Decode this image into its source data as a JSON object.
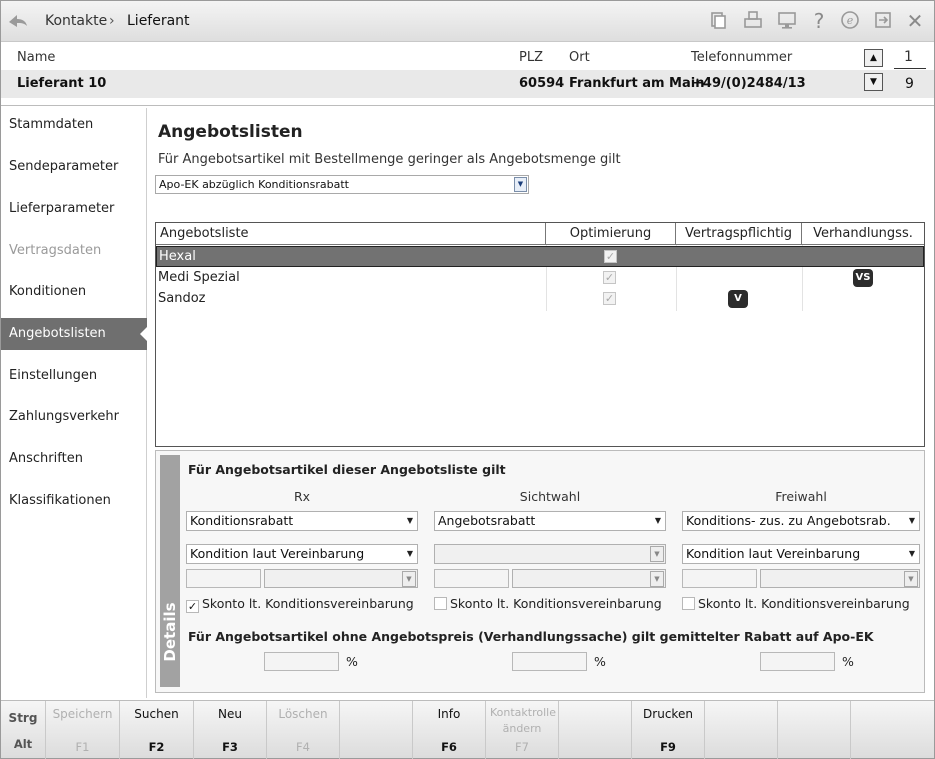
{
  "titlebar": {
    "breadcrumb": [
      "Kontakte",
      "Lieferant"
    ],
    "separator": "›",
    "icons": [
      "back-icon",
      "clipboard-icon",
      "printer-icon",
      "monitor-icon",
      "help-icon",
      "ebook-icon",
      "exit-icon",
      "close-icon"
    ]
  },
  "header": {
    "labels": {
      "name": "Name",
      "plz": "PLZ",
      "ort": "Ort",
      "tel": "Telefonnummer"
    },
    "values": {
      "name": "Lieferant 10",
      "plz": "60594",
      "ort": "Frankfurt am Main",
      "tel": "+49/(0)2484/13"
    },
    "page_current": "1",
    "page_total": "9"
  },
  "sidebar": {
    "items": [
      {
        "label": "Stammdaten",
        "state": "normal"
      },
      {
        "label": "Sendeparameter",
        "state": "normal"
      },
      {
        "label": "Lieferparameter",
        "state": "normal"
      },
      {
        "label": "Vertragsdaten",
        "state": "disabled"
      },
      {
        "label": "Konditionen",
        "state": "normal"
      },
      {
        "label": "Angebotslisten",
        "state": "active"
      },
      {
        "label": "Einstellungen",
        "state": "normal"
      },
      {
        "label": "Zahlungsverkehr",
        "state": "normal"
      },
      {
        "label": "Anschriften",
        "state": "normal"
      },
      {
        "label": "Klassifikationen",
        "state": "normal"
      }
    ]
  },
  "main": {
    "title": "Angebotslisten",
    "subtitle": "Für Angebotsartikel mit Bestellmenge geringer als Angebotsmenge gilt",
    "select_value": "Apo-EK abzüglich Konditionsrabatt",
    "table": {
      "headers": [
        "Angebotsliste",
        "Optimierung",
        "Vertragspflichtig",
        "Verhandlungss."
      ],
      "rows": [
        {
          "name": "Hexal",
          "optimierung": "✓",
          "vertrag": "",
          "verhandlung": "",
          "selected": true
        },
        {
          "name": "Medi Spezial",
          "optimierung": "✓",
          "vertrag": "",
          "verhandlung": "VS",
          "selected": false
        },
        {
          "name": "Sandoz",
          "optimierung": "✓",
          "vertrag": "V",
          "verhandlung": "",
          "selected": false
        }
      ]
    },
    "details": {
      "stripe": "Details",
      "heading1": "Für Angebotsartikel dieser Angebotsliste gilt",
      "columns": [
        {
          "head": "Rx",
          "combo1": "Konditionsrabatt",
          "combo2": "Kondition laut Vereinbarung",
          "skonto": "Skonto lt. Konditionsvereinbarung",
          "skonto_checked": "✓",
          "combo2_disabled": false
        },
        {
          "head": "Sichtwahl",
          "combo1": "Angebotsrabatt",
          "combo2": "",
          "skonto": "Skonto lt. Konditionsvereinbarung",
          "skonto_checked": "",
          "combo2_disabled": true
        },
        {
          "head": "Freiwahl",
          "combo1": "Konditions- zus. zu Angebotsrab.",
          "combo2": "Kondition laut Vereinbarung",
          "skonto": "Skonto lt. Konditionsvereinbarung",
          "skonto_checked": "",
          "combo2_disabled": false
        }
      ],
      "heading2": "Für Angebotsartikel ohne Angebotspreis (Verhandlungssache) gilt gemittelter Rabatt auf Apo-EK",
      "percent": "%"
    }
  },
  "footer": {
    "modifiers": [
      "Strg",
      "Alt"
    ],
    "keys": [
      {
        "label": "Speichern",
        "key": "F1",
        "enabled": false
      },
      {
        "label": "Suchen",
        "key": "F2",
        "enabled": true
      },
      {
        "label": "Neu",
        "key": "F3",
        "enabled": true
      },
      {
        "label": "Löschen",
        "key": "F4",
        "enabled": false
      },
      {
        "label": "",
        "key": "",
        "enabled": false
      },
      {
        "label": "Info",
        "key": "F6",
        "enabled": true
      },
      {
        "label": "Kontaktrolle ändern",
        "key": "F7",
        "enabled": false
      },
      {
        "label": "",
        "key": "",
        "enabled": false
      },
      {
        "label": "Drucken",
        "key": "F9",
        "enabled": true
      },
      {
        "label": "",
        "key": "",
        "enabled": false
      },
      {
        "label": "",
        "key": "",
        "enabled": false
      },
      {
        "label": "",
        "key": "",
        "enabled": false
      }
    ]
  }
}
